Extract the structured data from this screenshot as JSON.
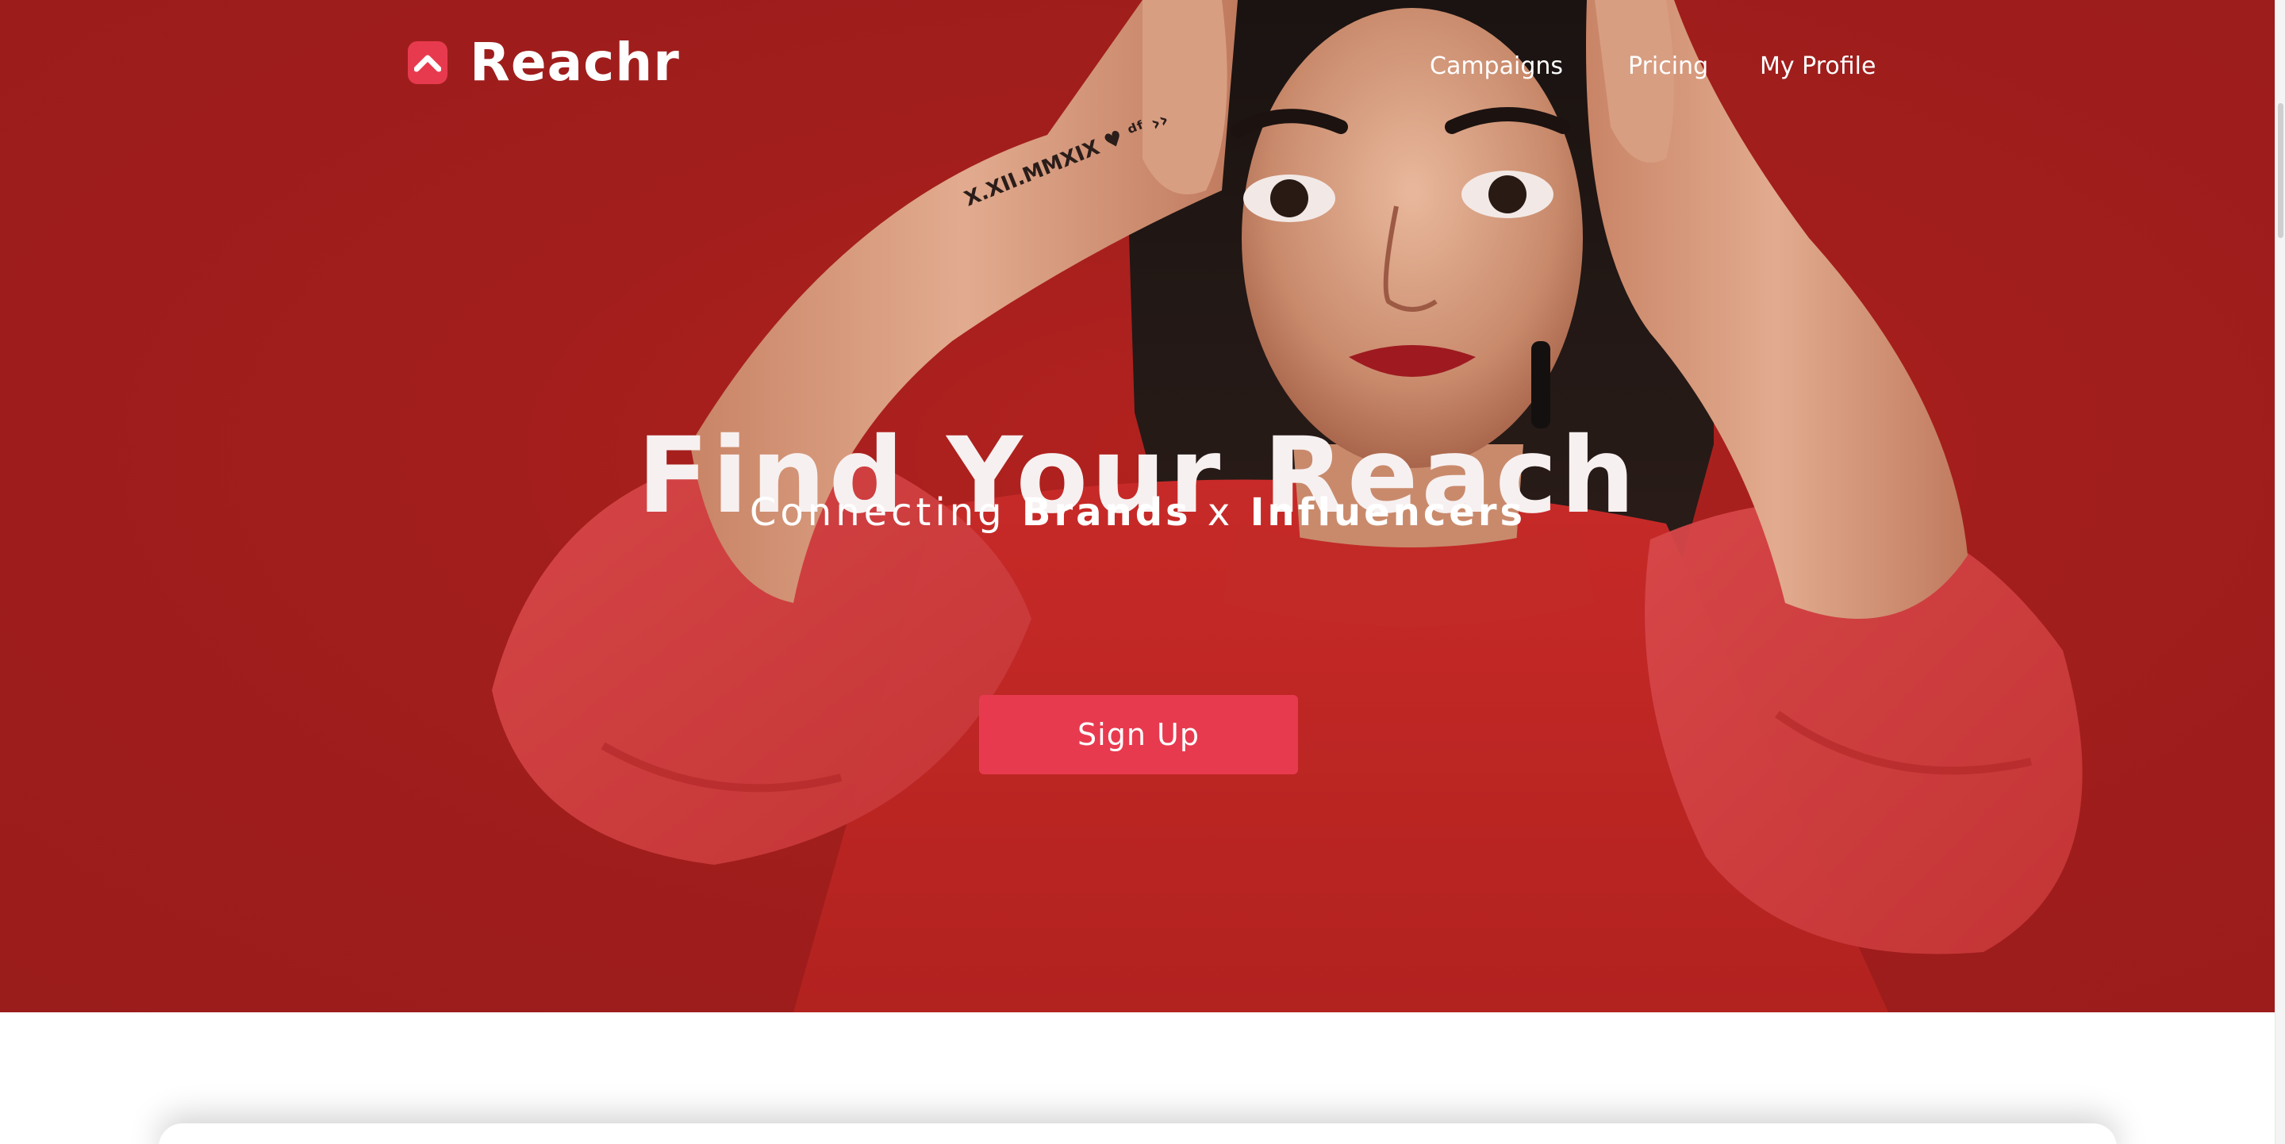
{
  "brand": {
    "name": "Reachr",
    "accent_color": "#e83a4e",
    "hero_background": "#a11e1c",
    "logo_icon": "chevron-up-icon"
  },
  "nav": {
    "items": [
      {
        "label": "Campaigns"
      },
      {
        "label": "Pricing"
      },
      {
        "label": "My Profile"
      }
    ]
  },
  "hero": {
    "title": "Find Your Reach",
    "subtitle_prefix": "Connecting",
    "subtitle_brands": "Brands",
    "subtitle_x": "x",
    "subtitle_influencers": "Influencers",
    "cta_label": "Sign Up"
  }
}
